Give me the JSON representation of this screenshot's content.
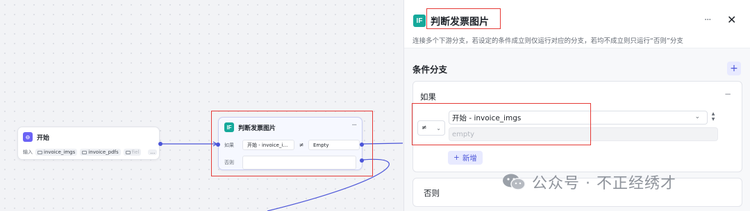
{
  "canvas": {
    "start_node": {
      "title": "开始",
      "input_label": "输入",
      "inputs": [
        "invoice_imgs",
        "invoice_pdfs",
        "fiel"
      ],
      "more": "…"
    },
    "if_node": {
      "icon": "IF",
      "title": "判断发票图片",
      "menu": "···",
      "if_label": "如果",
      "condition_variable": "开始 - invoice_i…",
      "condition_operator": "≠",
      "condition_value": "Empty",
      "else_label": "否则"
    }
  },
  "panel": {
    "icon": "IF",
    "title": "判断发票图片",
    "menu": "···",
    "close": "✕",
    "description": "连接多个下游分支，若设定的条件成立则仅运行对应的分支，若均不成立则只运行“否则”分支",
    "section_title": "条件分支",
    "add_branch": "+",
    "if_card": {
      "label": "如果",
      "collapse": "−",
      "operator": "≠",
      "variable": "开始 - invoice_imgs",
      "value_placeholder": "empty",
      "add_condition": "新增",
      "add_condition_icon": "+"
    },
    "else_card": {
      "label": "否则"
    }
  },
  "watermark": {
    "text": "公众号 · 不正经绣才"
  },
  "colors": {
    "accent": "#4b55d8",
    "if_icon": "#16a99b",
    "start_icon": "#6b63f5",
    "highlight": "#e53935"
  }
}
